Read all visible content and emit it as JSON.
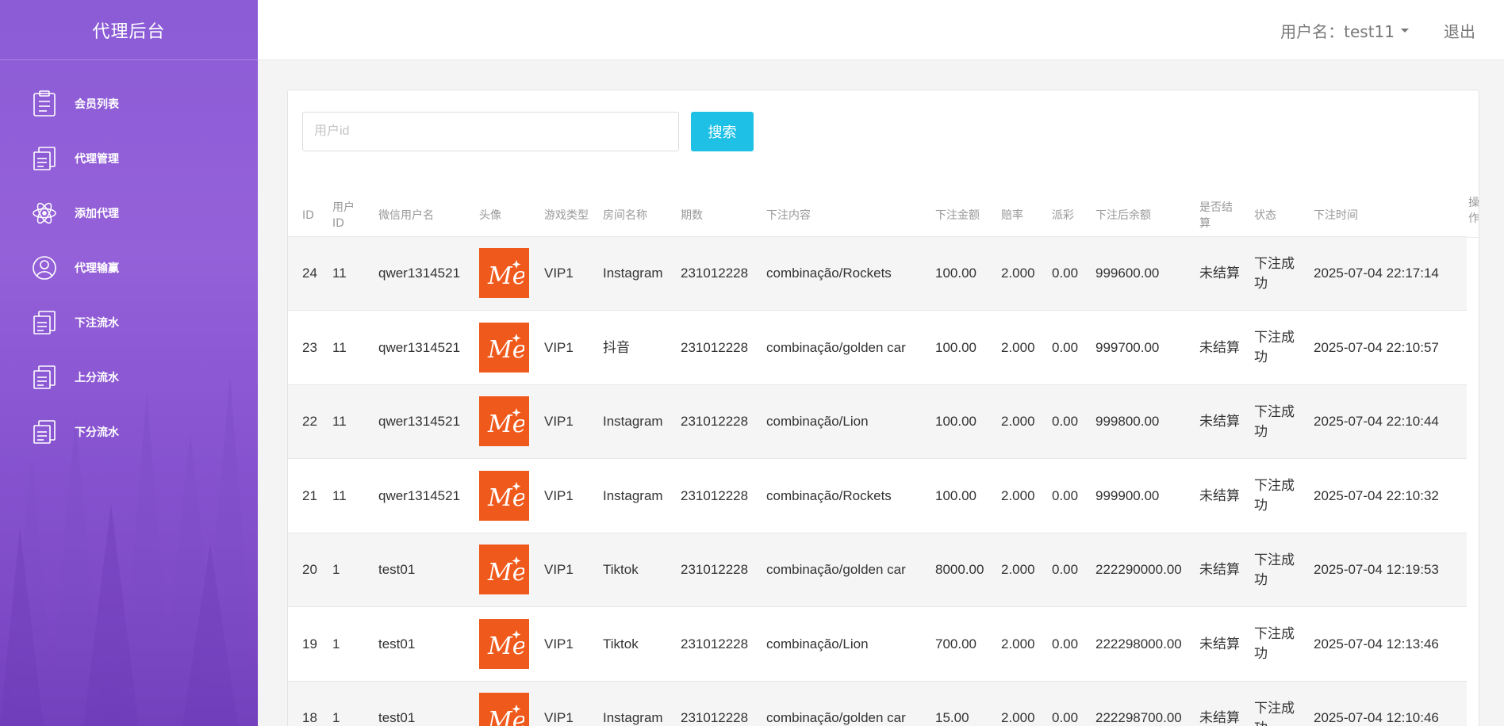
{
  "sidebar": {
    "title": "代理后台",
    "items": [
      {
        "label": "会员列表",
        "icon": "clipboard-icon"
      },
      {
        "label": "代理管理",
        "icon": "document-stack-icon"
      },
      {
        "label": "添加代理",
        "icon": "atom-icon"
      },
      {
        "label": "代理输赢",
        "icon": "user-circle-icon"
      },
      {
        "label": "下注流水",
        "icon": "document-stack-icon"
      },
      {
        "label": "上分流水",
        "icon": "document-stack-icon"
      },
      {
        "label": "下分流水",
        "icon": "document-stack-icon"
      }
    ]
  },
  "topbar": {
    "user_label": "用户名：test11",
    "logout_label": "退出"
  },
  "search": {
    "placeholder": "用户id",
    "value": "",
    "button_label": "搜索"
  },
  "table": {
    "columns": [
      "ID",
      "用户ID",
      "微信用户名",
      "头像",
      "游戏类型",
      "房间名称",
      "期数",
      "下注内容",
      "下注金额",
      "赔率",
      "派彩",
      "下注后余额",
      "是否结算",
      "状态",
      "下注时间",
      "操作"
    ],
    "avatar_text": "Me",
    "rows": [
      {
        "id": "24",
        "user_id": "11",
        "wx_name": "qwer1314521",
        "game_type": "VIP1",
        "room": "Instagram",
        "period": "231012228",
        "content": "combinação/Rockets",
        "amount": "100.00",
        "odds": "2.000",
        "payout": "0.00",
        "balance": "999600.00",
        "settled": "未结算",
        "status": "下注成功",
        "time": "2025-07-04 22:17:14"
      },
      {
        "id": "23",
        "user_id": "11",
        "wx_name": "qwer1314521",
        "game_type": "VIP1",
        "room": "抖音",
        "period": "231012228",
        "content": "combinação/golden car",
        "amount": "100.00",
        "odds": "2.000",
        "payout": "0.00",
        "balance": "999700.00",
        "settled": "未结算",
        "status": "下注成功",
        "time": "2025-07-04 22:10:57"
      },
      {
        "id": "22",
        "user_id": "11",
        "wx_name": "qwer1314521",
        "game_type": "VIP1",
        "room": "Instagram",
        "period": "231012228",
        "content": "combinação/Lion",
        "amount": "100.00",
        "odds": "2.000",
        "payout": "0.00",
        "balance": "999800.00",
        "settled": "未结算",
        "status": "下注成功",
        "time": "2025-07-04 22:10:44"
      },
      {
        "id": "21",
        "user_id": "11",
        "wx_name": "qwer1314521",
        "game_type": "VIP1",
        "room": "Instagram",
        "period": "231012228",
        "content": "combinação/Rockets",
        "amount": "100.00",
        "odds": "2.000",
        "payout": "0.00",
        "balance": "999900.00",
        "settled": "未结算",
        "status": "下注成功",
        "time": "2025-07-04 22:10:32"
      },
      {
        "id": "20",
        "user_id": "1",
        "wx_name": "test01",
        "game_type": "VIP1",
        "room": "Tiktok",
        "period": "231012228",
        "content": "combinação/golden car",
        "amount": "8000.00",
        "odds": "2.000",
        "payout": "0.00",
        "balance": "222290000.00",
        "settled": "未结算",
        "status": "下注成功",
        "time": "2025-07-04 12:19:53"
      },
      {
        "id": "19",
        "user_id": "1",
        "wx_name": "test01",
        "game_type": "VIP1",
        "room": "Tiktok",
        "period": "231012228",
        "content": "combinação/Lion",
        "amount": "700.00",
        "odds": "2.000",
        "payout": "0.00",
        "balance": "222298000.00",
        "settled": "未结算",
        "status": "下注成功",
        "time": "2025-07-04 12:13:46"
      },
      {
        "id": "18",
        "user_id": "1",
        "wx_name": "test01",
        "game_type": "VIP1",
        "room": "Instagram",
        "period": "231012228",
        "content": "combinação/golden car",
        "amount": "15.00",
        "odds": "2.000",
        "payout": "0.00",
        "balance": "222298700.00",
        "settled": "未结算",
        "status": "下注成功",
        "time": "2025-07-04 12:10:46"
      }
    ]
  }
}
